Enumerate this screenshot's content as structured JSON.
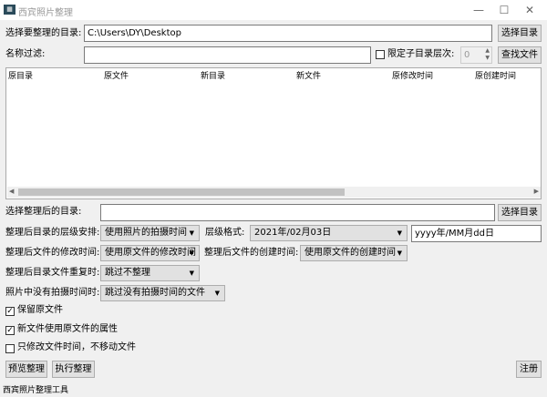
{
  "window": {
    "title": "西宾照片整理",
    "icon": "app-icon",
    "controls": {
      "minimize": "—",
      "maximize": "☐",
      "close": "✕"
    }
  },
  "source": {
    "label": "选择要整理的目录:",
    "value": "C:\\Users\\DY\\Desktop",
    "button": "选择目录"
  },
  "filter": {
    "label": "名称过滤:",
    "value": "",
    "limit_label": "限定子目录层次:",
    "limit_checked": false,
    "depth": "0",
    "button": "查找文件"
  },
  "table": {
    "columns": [
      "原目录",
      "原文件",
      "新目录",
      "新文件",
      "原修改时间",
      "原创建时间"
    ],
    "rows": []
  },
  "target": {
    "label": "选择整理后的目录:",
    "value": "",
    "button": "选择目录"
  },
  "hierarchy": {
    "label": "整理后目录的层级安排:",
    "value": "使用照片的拍摄时间",
    "format_label": "层级格式:",
    "format_value": "2021年/02月03日",
    "pattern": "yyyy年/MM月dd日"
  },
  "mtime": {
    "label": "整理后文件的修改时间:",
    "value": "使用原文件的修改时间",
    "ctime_label": "整理后文件的创建时间:",
    "ctime_value": "使用原文件的创建时间"
  },
  "duplicate": {
    "label": "整理后目录文件重复时:",
    "value": "跳过不整理"
  },
  "no_time": {
    "label": "照片中没有拍摄时间时:",
    "value": "跳过没有拍摄时间的文件"
  },
  "options": [
    {
      "label": "保留原文件",
      "checked": true
    },
    {
      "label": "新文件使用原文件的属性",
      "checked": true
    },
    {
      "label": "只修改文件时间，不移动文件",
      "checked": false
    }
  ],
  "actions": {
    "preview": "预览整理",
    "execute": "执行整理",
    "register": "注册"
  },
  "status": "西宾照片整理工具"
}
